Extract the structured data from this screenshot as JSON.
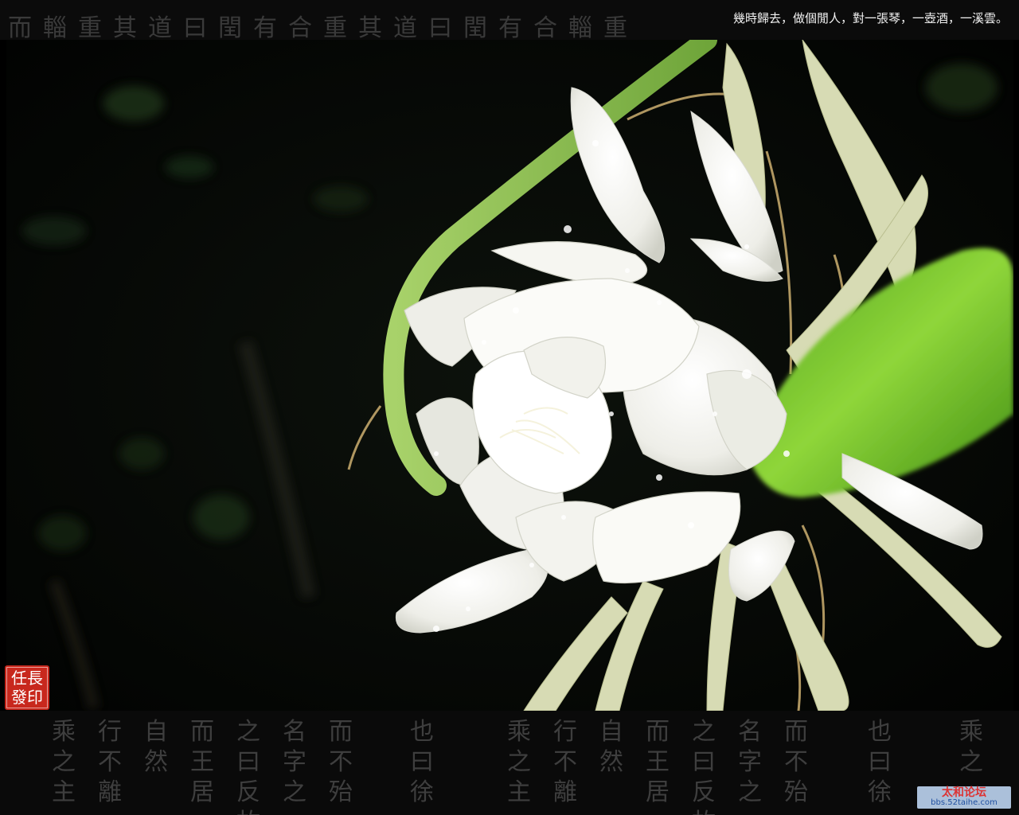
{
  "top_band": {
    "calligraphy": "而輜重其道曰閏有合重其道曰閏有合輜重",
    "poem": "幾時歸去，做個閒人，對一張琴，一壺酒，一溪雲。"
  },
  "bottom_band": {
    "calligraphy_columns": [
      "乘之主",
      "行不離",
      "自然",
      "而王居",
      "之曰反故",
      "名字之",
      "而不殆",
      "也曰徐",
      "乘之主",
      "行不離",
      "自然",
      "而王居",
      "之曰反故",
      "名字之",
      "而不殆",
      "也曰徐",
      "乘之"
    ]
  },
  "seal": {
    "text": "任長發印"
  },
  "watermark": {
    "title": "太和论坛",
    "url": "bbs.52taihe.com"
  },
  "photo": {
    "subject": "white-flower-icon"
  },
  "colors": {
    "background": "#000000",
    "seal": "#c8281d",
    "leaf": "#7dc82a",
    "petal": "#f4f4ef"
  }
}
